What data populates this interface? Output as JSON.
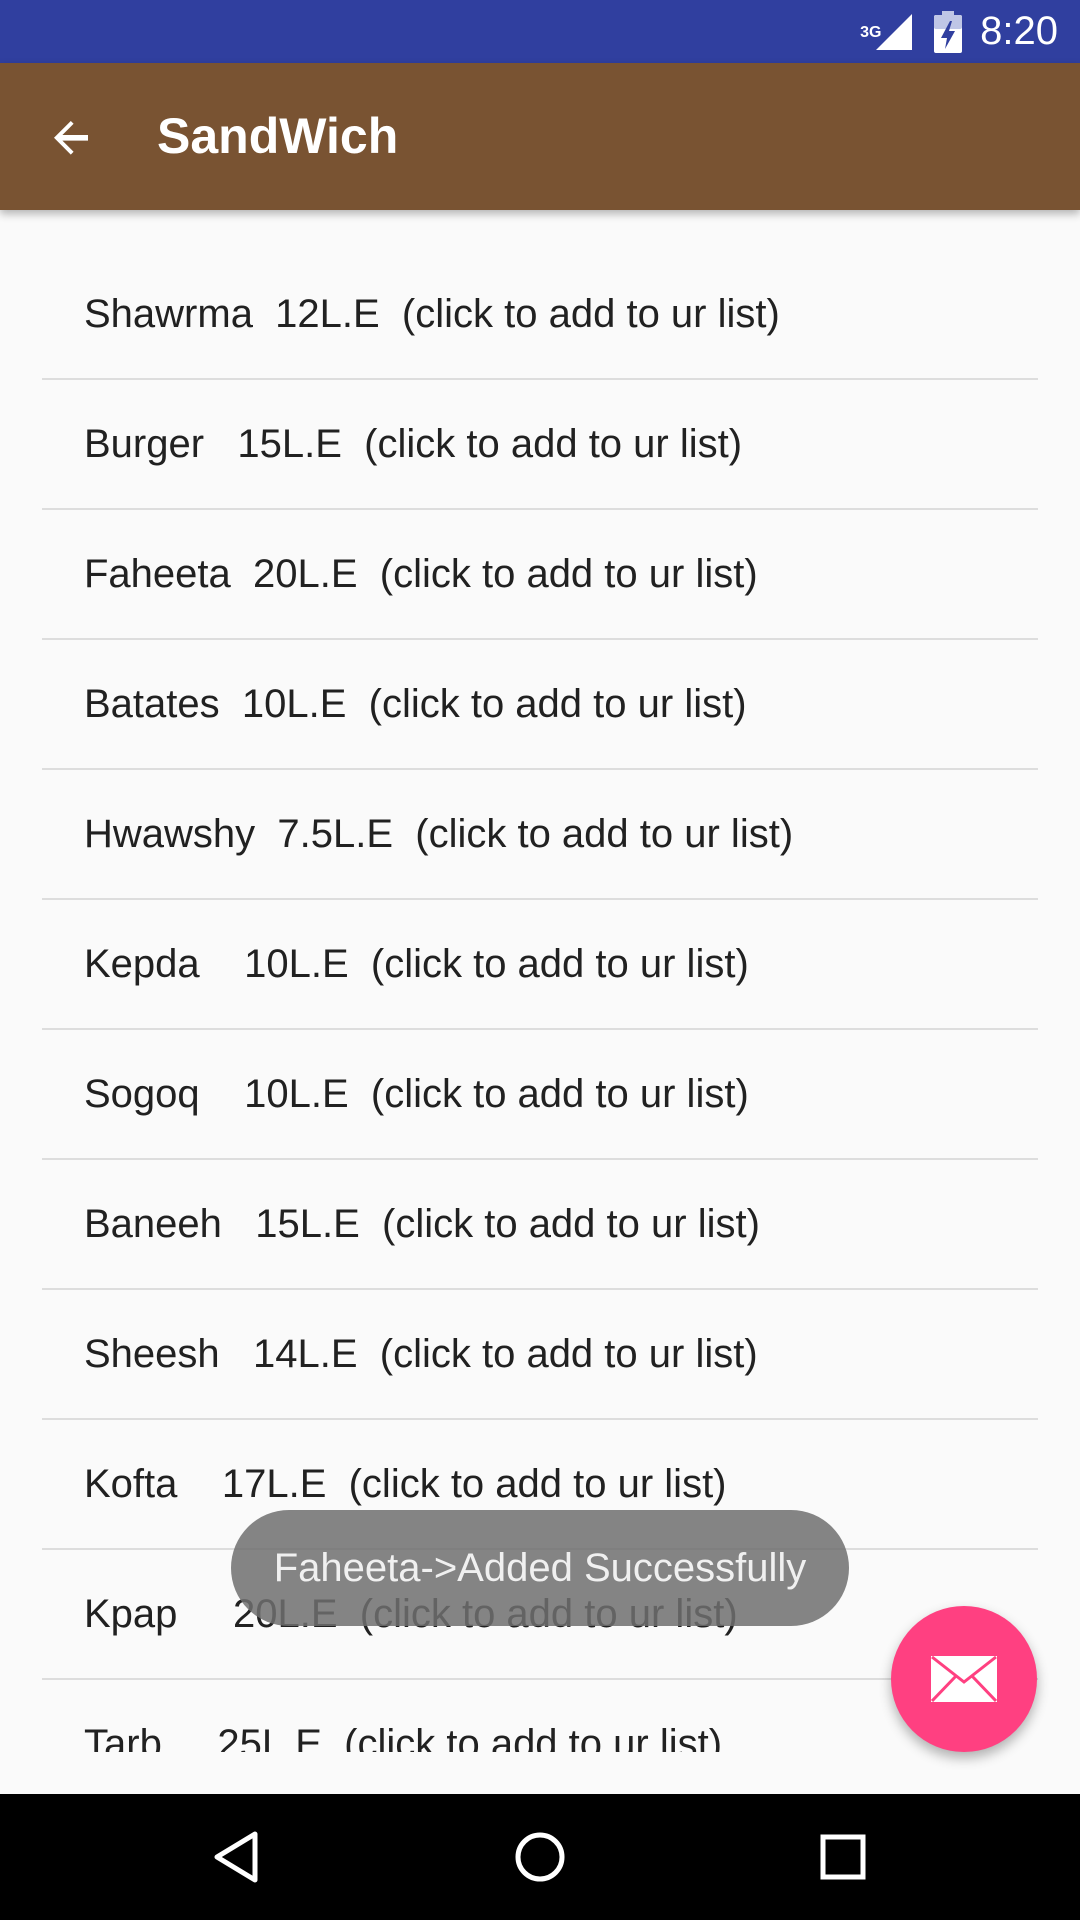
{
  "status_bar": {
    "network": "3G",
    "time": "8:20",
    "color": "#303f9f"
  },
  "app_bar": {
    "title": "SandWich",
    "back_icon": "arrow-back-icon",
    "color": "#795332"
  },
  "list": {
    "items": [
      {
        "label": "Shawrma  12L.E  (click to add to ur list)"
      },
      {
        "label": "Burger   15L.E  (click to add to ur list)"
      },
      {
        "label": "Faheeta  20L.E  (click to add to ur list)"
      },
      {
        "label": "Batates  10L.E  (click to add to ur list)"
      },
      {
        "label": "Hwawshy  7.5L.E  (click to add to ur list)"
      },
      {
        "label": "Kepda    10L.E  (click to add to ur list)"
      },
      {
        "label": "Sogoq    10L.E  (click to add to ur list)"
      },
      {
        "label": "Baneeh   15L.E  (click to add to ur list)"
      },
      {
        "label": "Sheesh   14L.E  (click to add to ur list)"
      },
      {
        "label": "Kofta    17L.E  (click to add to ur list)"
      },
      {
        "label": "Kpap     20L.E  (click to add to ur list)"
      },
      {
        "label": "Tarb     25L.E  (click to add to ur list)"
      }
    ]
  },
  "toast": {
    "message": "Faheeta->Added Successfully"
  },
  "fab": {
    "icon": "mail-icon",
    "color": "#ff4081"
  },
  "nav_bar": {
    "back_icon": "nav-back-icon",
    "home_icon": "nav-home-icon",
    "recents_icon": "nav-recents-icon"
  }
}
